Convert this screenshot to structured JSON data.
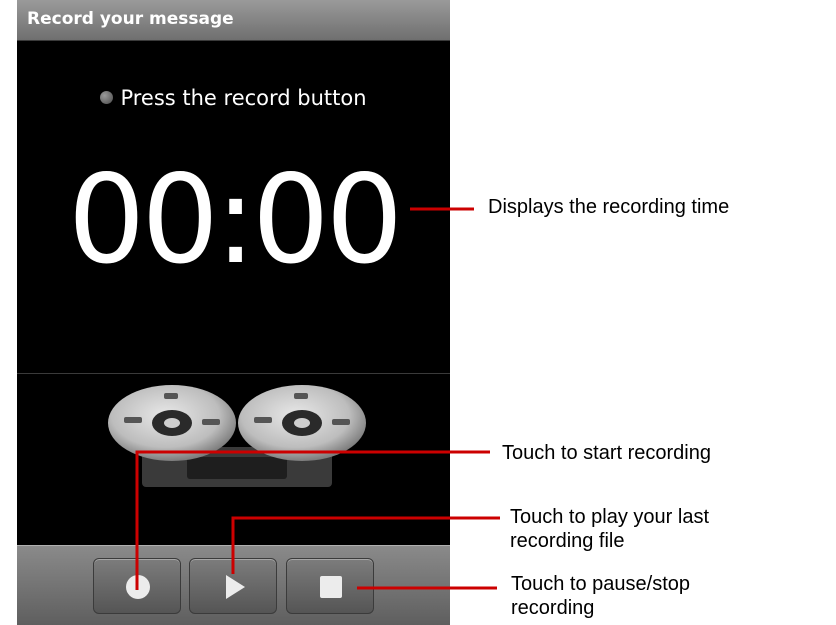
{
  "app": {
    "title": "Record your message"
  },
  "screen": {
    "status_text": "Press the record button",
    "timer": "00:00"
  },
  "controls": {
    "record_icon": "record-circle-icon",
    "play_icon": "play-triangle-icon",
    "stop_icon": "stop-square-icon"
  },
  "annotations": {
    "time": "Displays the recording time",
    "start": "Touch to start recording",
    "play_line1": "Touch to play your last",
    "play_line2": "recording file",
    "stop_line1": "Touch to pause/stop",
    "stop_line2": "recording"
  },
  "colors": {
    "callout_line": "#cc0000",
    "screen_bg": "#000000",
    "bar_gray": "#6f6f6f"
  }
}
